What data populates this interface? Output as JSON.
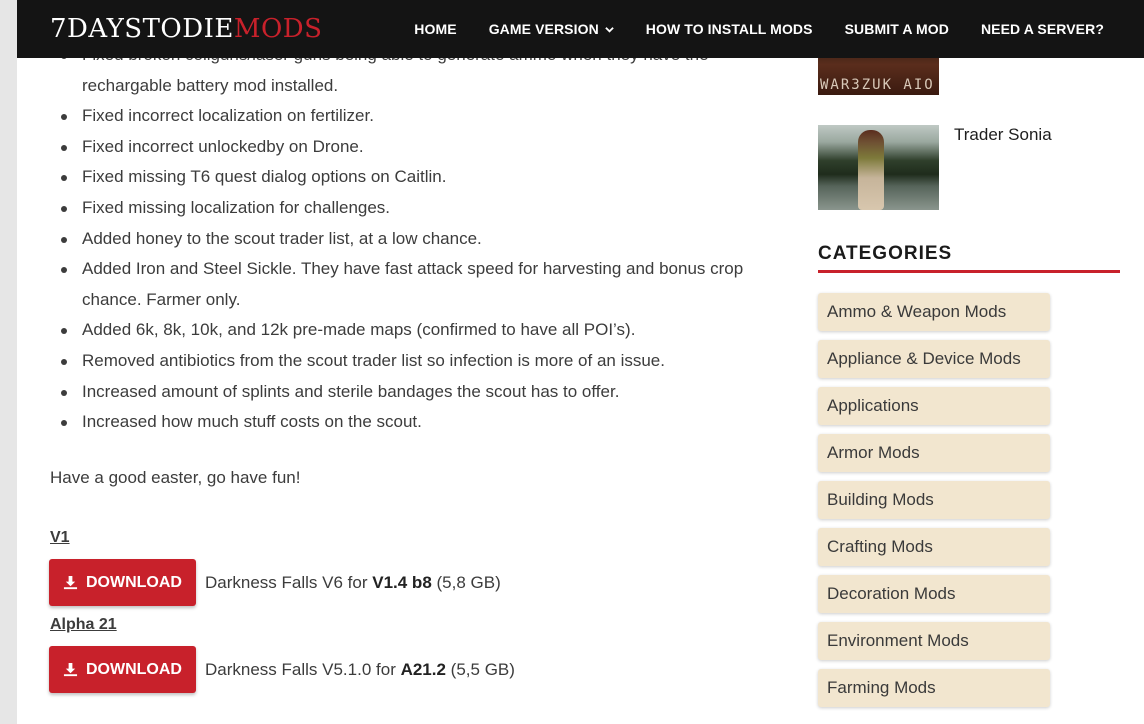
{
  "site": {
    "logo_main": "7DAYSTODIE",
    "logo_accent": "MODS"
  },
  "nav": {
    "items": [
      "HOME",
      "GAME VERSION",
      "HOW TO INSTALL MODS",
      "SUBMIT A MOD",
      "NEED A SERVER?"
    ]
  },
  "changelog": {
    "partial_first": "Fixed broken coilguns/laser guns being able to generate ammo when they have the rechargable battery mod installed.",
    "items": [
      "Fixed incorrect localization on fertilizer.",
      "Fixed incorrect unlockedby on Drone.",
      "Fixed missing T6 quest dialog options on Caitlin.",
      "Fixed missing localization for challenges.",
      "Added honey to the scout trader list, at a low chance.",
      "Added Iron and Steel Sickle. They have fast attack speed for harvesting and bonus crop chance. Farmer only.",
      "Added 6k, 8k, 10k, and 12k pre-made maps (confirmed to have all POI’s).",
      "Removed antibiotics from the scout trader list so infection is more of an issue.",
      "Increased amount of splints and sterile bandages the scout has to offer.",
      "Increased how much stuff costs on the scout."
    ],
    "closing": "Have a good easter, go have fun!"
  },
  "downloads": [
    {
      "label": "V1",
      "button": "DOWNLOAD",
      "desc_prefix": "Darkness Falls V6 for ",
      "version": "V1.4 b8",
      "size": " (5,8 GB)"
    },
    {
      "label": "Alpha 21",
      "button": "DOWNLOAD",
      "desc_prefix": "Darkness Falls V5.1.0 for ",
      "version": "A21.2",
      "size": " (5,5 GB)"
    }
  ],
  "sidebar": {
    "thumb1_text": "WAR3ZUK AIO",
    "post_title": "Trader Sonia",
    "categories_heading": "CATEGORIES",
    "categories": [
      "Ammo & Weapon Mods",
      "Appliance & Device Mods",
      "Applications",
      "Armor Mods",
      "Building Mods",
      "Crafting Mods",
      "Decoration Mods",
      "Environment Mods",
      "Farming Mods"
    ]
  },
  "colors": {
    "accent": "#c8212b",
    "header_bg": "#141414",
    "category_bg": "#f2e6cf"
  }
}
